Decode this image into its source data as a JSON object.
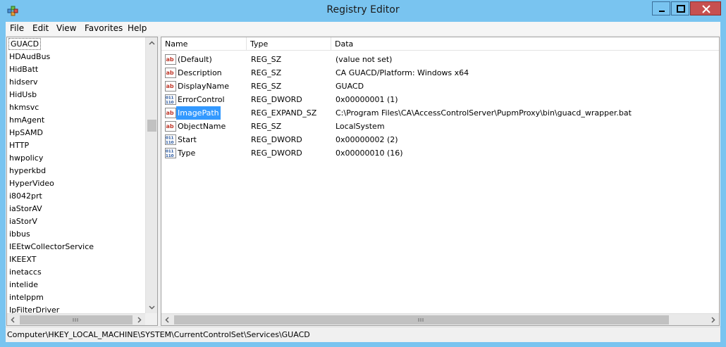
{
  "window": {
    "title": "Registry Editor"
  },
  "menu": [
    "File",
    "Edit",
    "View",
    "Favorites",
    "Help"
  ],
  "tree": {
    "selected": "GUACD",
    "items": [
      "GUACD",
      "HDAudBus",
      "HidBatt",
      "hidserv",
      "HidUsb",
      "hkmsvc",
      "hmAgent",
      "HpSAMD",
      "HTTP",
      "hwpolicy",
      "hyperkbd",
      "HyperVideo",
      "i8042prt",
      "iaStorAV",
      "iaStorV",
      "ibbus",
      "IEEtwCollectorService",
      "IKEEXT",
      "inetaccs",
      "intelide",
      "intelppm",
      "IpFilterDriver"
    ]
  },
  "columns": {
    "name": "Name",
    "type": "Type",
    "data": "Data"
  },
  "values": [
    {
      "icon": "string-value-icon",
      "name": "(Default)",
      "type": "REG_SZ",
      "data": "(value not set)"
    },
    {
      "icon": "string-value-icon",
      "name": "Description",
      "type": "REG_SZ",
      "data": "CA GUACD/Platform: Windows x64"
    },
    {
      "icon": "string-value-icon",
      "name": "DisplayName",
      "type": "REG_SZ",
      "data": "GUACD"
    },
    {
      "icon": "dword-value-icon",
      "name": "ErrorControl",
      "type": "REG_DWORD",
      "data": "0x00000001 (1)"
    },
    {
      "icon": "string-value-icon",
      "name": "ImagePath",
      "type": "REG_EXPAND_SZ",
      "data": "C:\\Program Files\\CA\\AccessControlServer\\PupmProxy\\bin\\guacd_wrapper.bat"
    },
    {
      "icon": "string-value-icon",
      "name": "ObjectName",
      "type": "REG_SZ",
      "data": "LocalSystem"
    },
    {
      "icon": "dword-value-icon",
      "name": "Start",
      "type": "REG_DWORD",
      "data": "0x00000002 (2)"
    },
    {
      "icon": "dword-value-icon",
      "name": "Type",
      "type": "REG_DWORD",
      "data": "0x00000010 (16)"
    }
  ],
  "selected_value": "ImagePath",
  "status": {
    "path": "Computer\\HKEY_LOCAL_MACHINE\\SYSTEM\\CurrentControlSet\\Services\\GUACD"
  },
  "colors": {
    "titlebar": "#79c4f0",
    "selection": "#3399ff",
    "close_button": "#c75050"
  }
}
